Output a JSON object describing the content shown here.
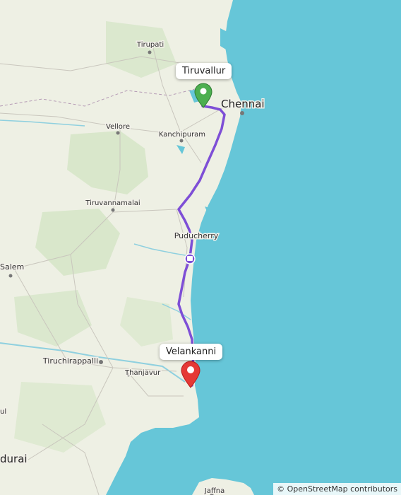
{
  "map": {
    "places": {
      "tirupati": "Tirupati",
      "chennai": "Chennai",
      "vellore": "Vellore",
      "kanchipuram": "Kanchipuram",
      "tiruvannamalai": "Tiruvannamalai",
      "puducherry": "Puducherry",
      "salem": "Salem",
      "tiruchirappalli": "Tiruchirappalli",
      "thanjavur": "Thanjavur",
      "madurai": "durai",
      "jaffna": "Jaffna",
      "edge_ul": "ul"
    },
    "start": {
      "label": "Tiruvallur",
      "marker": "green-pin-icon",
      "color": "#4caf50"
    },
    "end": {
      "label": "Velankanni",
      "marker": "red-pin-icon",
      "color": "#e53935"
    },
    "route_color": "#7e4fd6",
    "water_color": "#66c6d8",
    "land_color": "#eef0e4",
    "attribution": "© OpenStreetMap contributors"
  }
}
